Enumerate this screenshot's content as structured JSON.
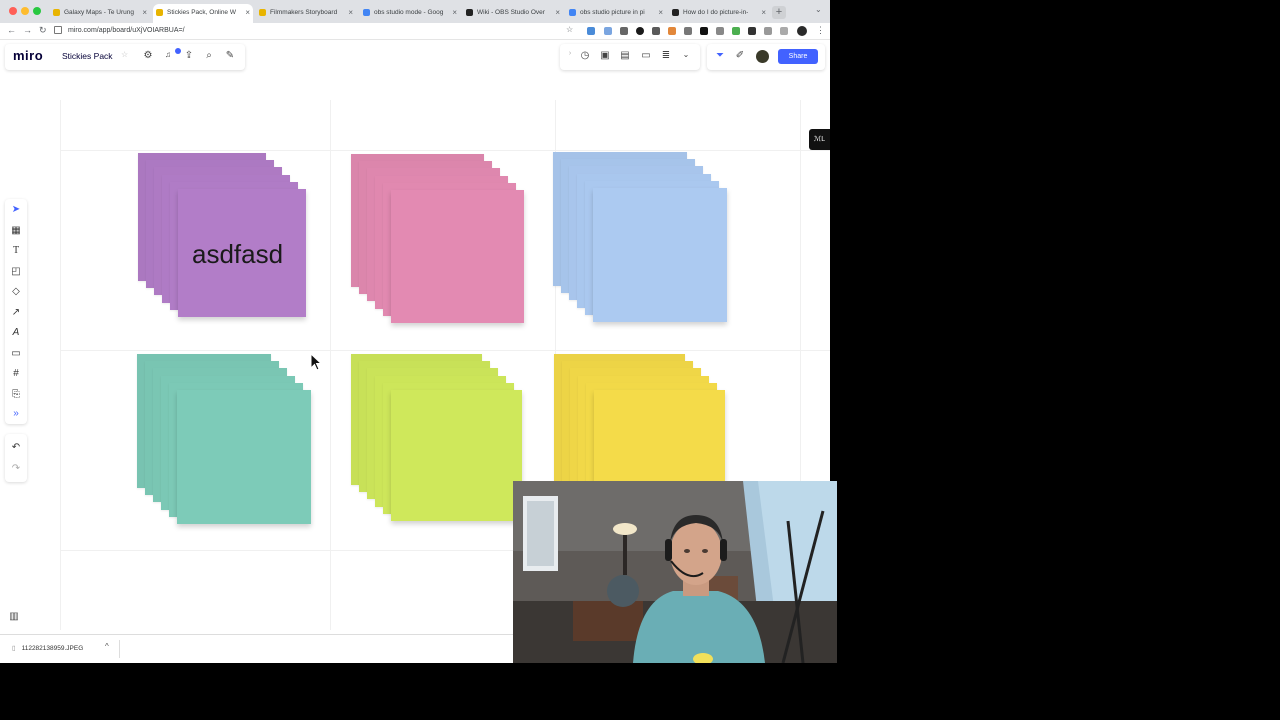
{
  "browser": {
    "tabs": [
      {
        "label": "Galaxy Maps - Te Urung",
        "favicon_color": "#e8b400"
      },
      {
        "label": "Stickies Pack, Online W",
        "favicon_color": "#e8b400"
      },
      {
        "label": "Filmmakers Storyboard",
        "favicon_color": "#e8b400"
      },
      {
        "label": "obs studio mode - Goog",
        "favicon_color": "#4285f4"
      },
      {
        "label": "Wiki - OBS Studio Over",
        "favicon_color": "#222222"
      },
      {
        "label": "obs studio picture in pi",
        "favicon_color": "#4285f4"
      },
      {
        "label": "How do I do picture-in-",
        "favicon_color": "#222222"
      }
    ],
    "active_tab": 1,
    "url": "miro.com/app/board/uXjVOIARBUA=/",
    "close_glyph": "×",
    "new_tab_glyph": "+",
    "menu_glyph": "⌄"
  },
  "miro": {
    "logo": "miro",
    "board_name": "Stickies Pack",
    "notification_count": "1",
    "share_label": "Share",
    "side_badge": "ℳL"
  },
  "icons": {
    "back": "←",
    "forward": "→",
    "reload": "↻",
    "star": "☆",
    "settings": "⚙",
    "bell": "🔔",
    "upload": "⇪",
    "search": "⌕",
    "magic": "✎",
    "chevron": "⌄",
    "timer": "◷",
    "frame": "▣",
    "doc": "▤",
    "comment": "▭",
    "list": "≣",
    "filter": "⏷",
    "pen": "✐",
    "people": "👥",
    "select": "➤",
    "table": "▦",
    "text": "T",
    "note": "◰",
    "shape": "◇",
    "line": "↗",
    "pen2": "A",
    "comment2": "▭",
    "frame2": "#",
    "upload2": "⎘",
    "more": "»",
    "undo": "↶",
    "redo": "↷",
    "frames": "▥"
  },
  "stickies": [
    {
      "color": "#b07cc6",
      "text": "asdfasd"
    },
    {
      "color": "#e189b0",
      "text": ""
    },
    {
      "color": "#aac8ef",
      "text": ""
    },
    {
      "color": "#7cc9b6",
      "text": ""
    },
    {
      "color": "#cde65a",
      "text": ""
    },
    {
      "color": "#f2d948",
      "text": ""
    }
  ],
  "download": {
    "filename": "112282138959.JPEG",
    "caret": "^"
  }
}
